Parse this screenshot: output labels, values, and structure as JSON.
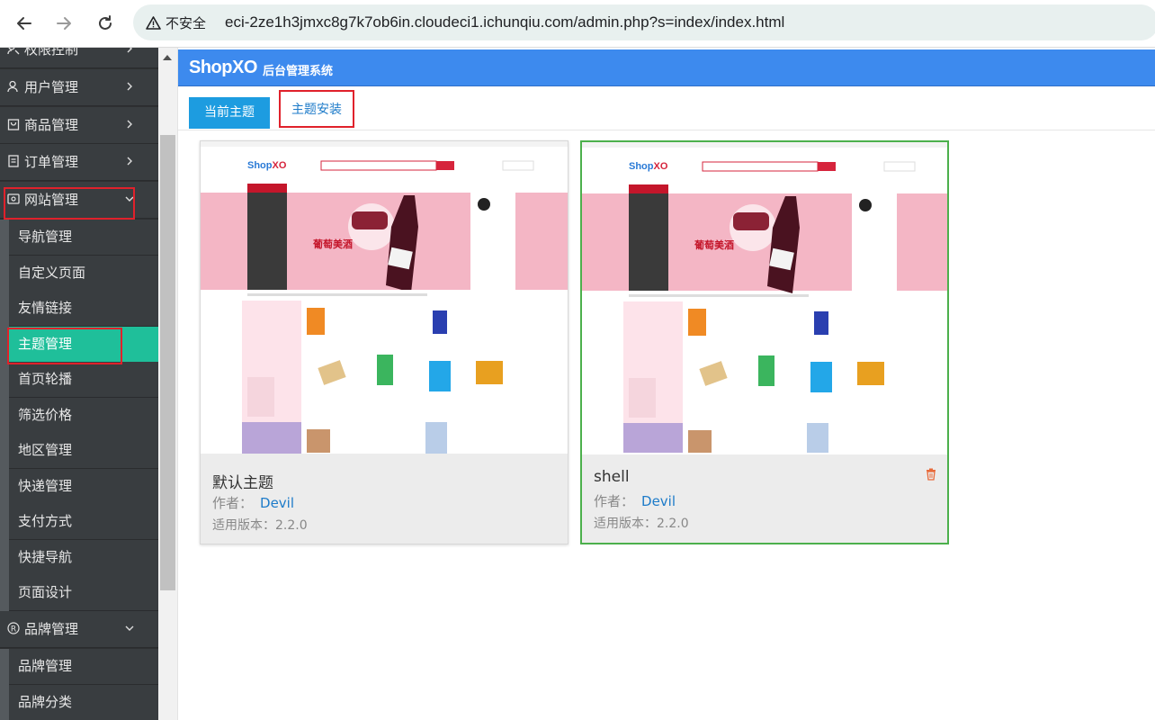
{
  "browser": {
    "insecure_label": "不安全",
    "url": "eci-2ze1h3jmxc8g7k7ob6in.cloudeci1.ichunqiu.com/admin.php?s=index/index.html"
  },
  "sidebar": {
    "top_partial": "权限控制",
    "items": [
      {
        "label": "用户管理",
        "icon": "user-icon"
      },
      {
        "label": "商品管理",
        "icon": "bag-icon"
      },
      {
        "label": "订单管理",
        "icon": "document-icon"
      },
      {
        "label": "网站管理",
        "icon": "website-icon"
      }
    ],
    "website_sub": [
      "导航管理",
      "自定义页面",
      "友情链接",
      "主题管理",
      "首页轮播",
      "筛选价格",
      "地区管理",
      "快递管理",
      "支付方式",
      "快捷导航",
      "页面设计"
    ],
    "active_sub": "主题管理",
    "brand": {
      "label": "品牌管理",
      "icon": "registered-icon"
    },
    "brand_sub": [
      "品牌管理",
      "品牌分类"
    ]
  },
  "header": {
    "logo": "ShopXO",
    "subtitle": "后台管理系统"
  },
  "tabs": {
    "current": "当前主题",
    "install": "主题安装"
  },
  "themes": [
    {
      "name": "默认主题",
      "author_label": "作者：",
      "author": "Devil",
      "version_label": "适用版本：",
      "version": "2.2.0"
    },
    {
      "name": "shell",
      "author_label": "作者：",
      "author": "Devil",
      "version_label": "适用版本：",
      "version": "2.2.0"
    }
  ],
  "colors": {
    "header_blue": "#3d8aee",
    "active_green": "#1fbf9a",
    "selected_border": "#4cb04c",
    "tab_blue": "#1d9ce0",
    "highlight_red": "#e0212b"
  }
}
